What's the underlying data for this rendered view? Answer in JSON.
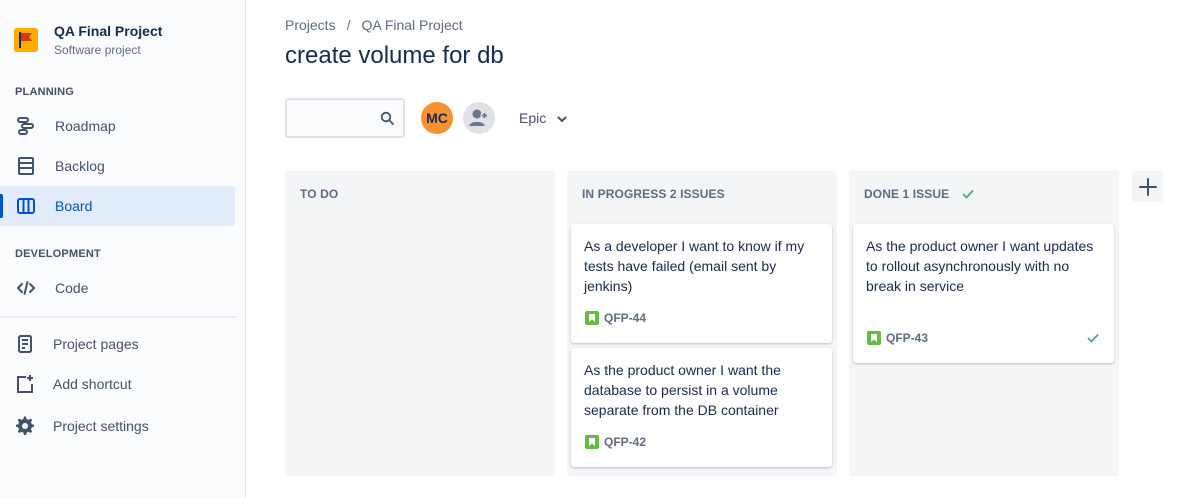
{
  "sidebar": {
    "project_name": "QA Final Project",
    "project_type": "Software project",
    "planning_title": "PLANNING",
    "planning_items": [
      {
        "label": "Roadmap",
        "icon": "roadmap-icon"
      },
      {
        "label": "Backlog",
        "icon": "backlog-icon"
      },
      {
        "label": "Board",
        "icon": "board-icon",
        "active": true
      }
    ],
    "development_title": "DEVELOPMENT",
    "development_items": [
      {
        "label": "Code",
        "icon": "code-icon"
      }
    ],
    "utility_items": [
      {
        "label": "Project pages",
        "icon": "project-pages-icon"
      },
      {
        "label": "Add shortcut",
        "icon": "add-shortcut-icon"
      },
      {
        "label": "Project settings",
        "icon": "gear-icon"
      }
    ]
  },
  "breadcrumb": {
    "projects": "Projects",
    "separator": "/",
    "project": "QA Final Project"
  },
  "page_title": "create volume for db",
  "toolbar": {
    "search_value": "",
    "avatar_initials": "MC",
    "epic_label": "Epic"
  },
  "columns": [
    {
      "title": "TO DO",
      "cards": []
    },
    {
      "title": "IN PROGRESS 2 ISSUES",
      "cards": [
        {
          "summary": "As a developer I want to know if my tests have failed (email sent by jenkins)",
          "key": "QFP-44"
        },
        {
          "summary": "As the product owner I want the database to persist in a volume separate from the DB container",
          "key": "QFP-42"
        }
      ]
    },
    {
      "title": "DONE 1 ISSUE",
      "cards": [
        {
          "summary": "As the product owner I want updates to rollout asynchronously with no break in service",
          "key": "QFP-43",
          "done": true
        }
      ]
    }
  ],
  "colors": {
    "accent": "#0052cc",
    "active_bg": "#e3ecfb",
    "avatar": "#f79232",
    "story": "#65ba43",
    "done": "#36b37e"
  }
}
